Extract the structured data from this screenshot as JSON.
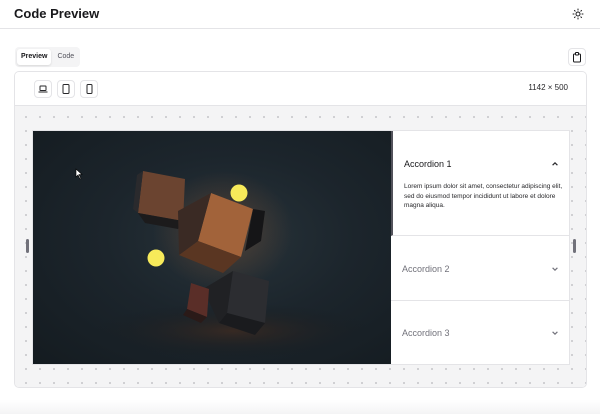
{
  "header": {
    "title": "Code Preview",
    "theme_icon": "sun-icon"
  },
  "tabs": [
    {
      "label": "Preview",
      "active": true
    },
    {
      "label": "Code",
      "active": false
    }
  ],
  "toolbar": {
    "devices": [
      "laptop-icon",
      "tablet-icon",
      "mobile-icon"
    ],
    "viewport_size": "1142 × 500",
    "clipboard_icon": "clipboard-icon"
  },
  "accordion": {
    "items": [
      {
        "title": "Accordion 1",
        "expanded": true,
        "body": "Lorem ipsum dolor sit amet, consectetur adipiscing elit, sed do eiusmod tempor incididunt ut labore et dolore magna aliqua."
      },
      {
        "title": "Accordion 2",
        "expanded": false
      },
      {
        "title": "Accordion 3",
        "expanded": false
      }
    ]
  },
  "colors": {
    "accent_yellow": "#f7ea5a",
    "cube_orange": "#8a5430",
    "image_background": "#1c252c",
    "border": "#e4e4e7"
  }
}
